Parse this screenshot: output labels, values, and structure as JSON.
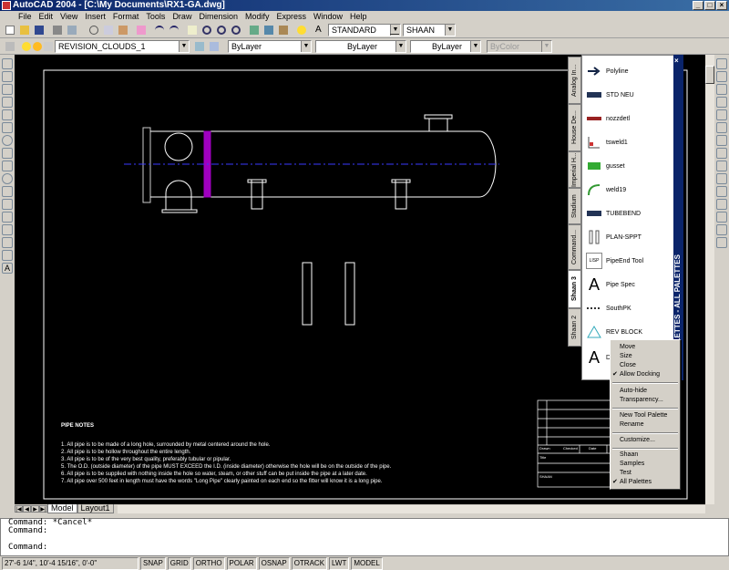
{
  "window": {
    "title": "AutoCAD 2004 - [C:\\My Documents\\RX1-GA.dwg]",
    "buttons": [
      "_",
      "□",
      "×"
    ]
  },
  "menu": [
    "File",
    "Edit",
    "View",
    "Insert",
    "Format",
    "Tools",
    "Draw",
    "Dimension",
    "Modify",
    "Express",
    "Window",
    "Help"
  ],
  "toolbar": {
    "text_style": "STANDARD",
    "dim_style": "SHAAN",
    "layer": "REVISION_CLOUDS_1",
    "color": "ByLayer",
    "linetype": "ByLayer",
    "lineweight": "ByLayer",
    "plot_style": "ByColor"
  },
  "drawing": {
    "notes_title": "PIPE NOTES",
    "notes": [
      "1.   All pipe is to be made of a long hole, surrounded by metal centered around the hole.",
      "2.   All pipe is to be hollow throughout the entire length.",
      "3.   All pipe is to be of the very best quality, preferably tubular or pipular.",
      "5.   The O.D. (outside diameter) of the pipe MUST EXCEED the I.D. (inside diameter) otherwise the hole will be on the   outside of the pipe.",
      "6.   All pipe is to be supplied with nothing inside the hole so water, steam, or other stuff can be put inside the pipe at a later date.",
      "7.   All pipe over 500 feet in length must have the words \"Long Pipe\" clearly painted on each end so the fitter will know it is a long pipe."
    ],
    "titleblock": [
      "Drawn",
      "Checked",
      "Date",
      "Title",
      "SHAAN"
    ]
  },
  "palette": {
    "title": "TOOL PALETTES - ALL PALETTES",
    "tabs": [
      "Analog In...",
      "House De...",
      "Imperial H...",
      "Stadium",
      "Command...",
      "Shaan 3",
      "Shaan 2"
    ],
    "items": [
      "Polyline",
      "STD NEU",
      "nozzdetl",
      "tsweld1",
      "gusset",
      "weld19",
      "TUBEBEND",
      "PLAN-SPPT",
      "PipeEnd Tool",
      "Pipe Spec",
      "SouthPK",
      "REV BLOCK",
      "D"
    ],
    "text_icon": "A"
  },
  "context_menu": {
    "items": [
      "Move",
      "Size",
      "Close",
      "Allow Docking",
      "Auto-hide",
      "Transparency...",
      "New Tool Palette",
      "Rename",
      "Customize...",
      "Shaan",
      "Samples",
      "Test",
      "All Palettes"
    ],
    "checked": [
      "Allow Docking",
      "All Palettes"
    ]
  },
  "layout_tabs": [
    "Model",
    "Layout1"
  ],
  "command": {
    "lines": [
      "Command: *Cancel*",
      "Command:",
      "",
      "Command:"
    ]
  },
  "status": {
    "coords": "27'-6 1/4\",  10'-4 15/16\", 0'-0\"",
    "toggles": [
      "SNAP",
      "GRID",
      "ORTHO",
      "POLAR",
      "OSNAP",
      "OTRACK",
      "LWT",
      "MODEL"
    ]
  },
  "colors": {
    "title_bar": "#0a246a",
    "canvas": "#000000",
    "drawing_lines": "#ffffff",
    "centerline": "#3a3aff",
    "stiffener": "#b000b0"
  }
}
